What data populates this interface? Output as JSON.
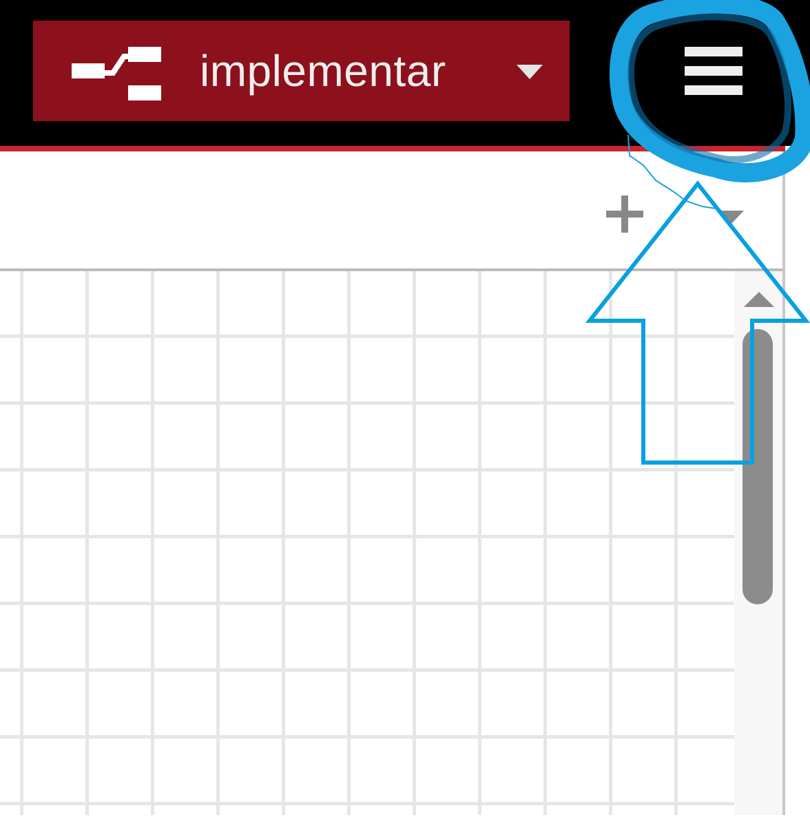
{
  "header": {
    "deploy_button": {
      "label": "implementar",
      "icon": "flow-deploy-icon",
      "caret_icon": "caret-down-icon"
    },
    "menu_button": {
      "icon": "hamburger-menu-icon"
    },
    "colors": {
      "background": "#000000",
      "deploy_bg": "#8c111c",
      "accent": "#c8252c"
    }
  },
  "tabbar": {
    "add_icon": "plus-icon",
    "list_icon": "caret-down-icon"
  },
  "workspace": {
    "grid": true,
    "scrollbar": {
      "up_icon": "caret-up-icon"
    }
  },
  "annotation": {
    "circle_color": "#1aa3e0",
    "arrow_color": "#0aa0e0",
    "arrow_icon": "arrow-up-outline-icon"
  }
}
